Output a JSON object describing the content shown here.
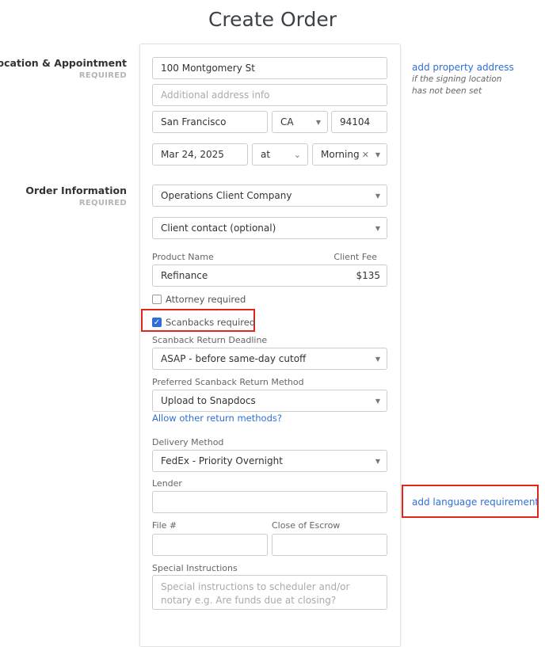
{
  "page_title": "Create Order",
  "sections": {
    "location": {
      "heading": "Location & Appointment",
      "required": "REQUIRED"
    },
    "order": {
      "heading": "Order Information",
      "required": "REQUIRED"
    }
  },
  "location": {
    "address": "100 Montgomery St",
    "additional_placeholder": "Additional address info",
    "city": "San Francisco",
    "state": "CA",
    "zip": "94104",
    "date": "Mar 24, 2025",
    "time_mode": "at",
    "time_of_day": "Morning",
    "add_property_link": "add property address",
    "add_property_hint_1": "if the signing location",
    "add_property_hint_2": "has not been set"
  },
  "order": {
    "client_company": "Operations Client Company",
    "client_contact": "Client contact (optional)",
    "product_label": "Product Name",
    "fee_label": "Client Fee",
    "product": "Refinance",
    "fee": "$135",
    "attorney_label": "Attorney required",
    "attorney_checked": false,
    "scanbacks_label": "Scanbacks required",
    "scanbacks_checked": true,
    "deadline_label": "Scanback Return Deadline",
    "deadline": "ASAP - before same-day cutoff",
    "return_method_label": "Preferred Scanback Return Method",
    "return_method": "Upload to Snapdocs",
    "allow_other_link": "Allow other return methods?",
    "delivery_label": "Delivery Method",
    "delivery": "FedEx - Priority Overnight",
    "lender_label": "Lender",
    "lender": "",
    "add_language_link": "add language requirement",
    "file_label": "File #",
    "file": "",
    "escrow_label": "Close of Escrow",
    "escrow": "",
    "instructions_label": "Special Instructions",
    "instructions_placeholder": "Special instructions to scheduler and/or notary e.g. Are funds due at closing?"
  },
  "colors": {
    "link": "#2f6fd6",
    "highlight": "#e0261b",
    "checkbox": "#2f6fd6"
  }
}
